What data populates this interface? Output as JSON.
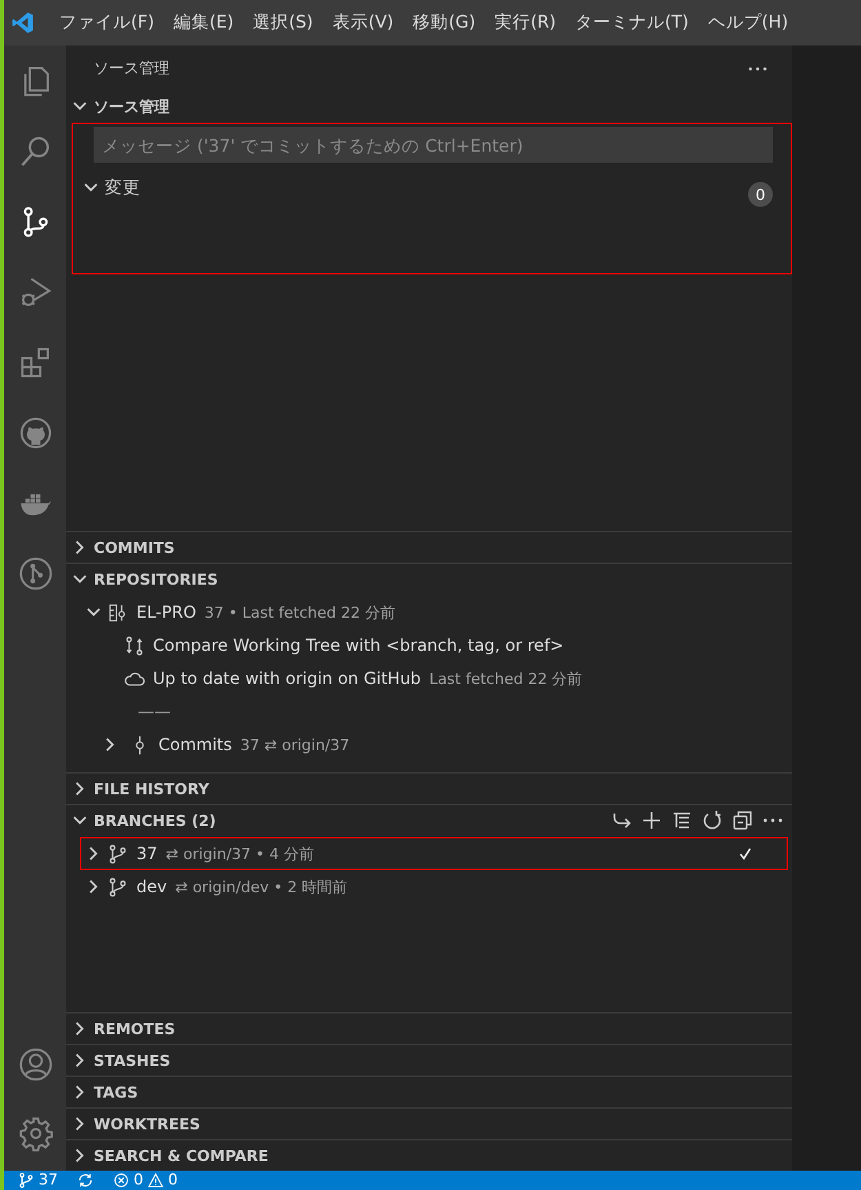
{
  "menu": [
    "ファイル(F)",
    "編集(E)",
    "選択(S)",
    "表示(V)",
    "移動(G)",
    "実行(R)",
    "ターミナル(T)",
    "ヘルプ(H)"
  ],
  "activity_bar": [
    {
      "kind": "files",
      "selected": false
    },
    {
      "kind": "search",
      "selected": false
    },
    {
      "kind": "scm",
      "selected": true
    },
    {
      "kind": "debug",
      "selected": false
    },
    {
      "kind": "extensions",
      "selected": false
    },
    {
      "kind": "github",
      "selected": false
    },
    {
      "kind": "docker",
      "selected": false
    },
    {
      "kind": "gitgraph",
      "selected": false
    }
  ],
  "activity_bottom": [
    {
      "kind": "account"
    },
    {
      "kind": "settings"
    }
  ],
  "sidebar": {
    "title": "ソース管理",
    "scm": {
      "title": "ソース管理",
      "expanded": true,
      "annotated": true,
      "placeholder": "メッセージ ('37' でコミットするための Ctrl+Enter)",
      "changes": {
        "label": "変更",
        "count": "0",
        "expanded": true
      }
    },
    "sections_top": [
      {
        "title": "COMMITS",
        "expanded": false
      }
    ],
    "repositories": {
      "title": "REPOSITORIES",
      "expanded": true,
      "repo": {
        "label": "EL-PRO",
        "description": "37 • Last fetched 22 分前",
        "expanded": true,
        "children": [
          {
            "kind": "compare",
            "label": "Compare Working Tree with <branch, tag, or ref>"
          },
          {
            "kind": "status",
            "label": "Up to date with origin on GitHub",
            "description": "Last fetched 22 分前"
          },
          {
            "kind": "separator",
            "label": "——"
          },
          {
            "kind": "commits",
            "label": "Commits",
            "description": "37 ⇄ origin/37",
            "expanded": false
          }
        ]
      }
    },
    "file_history": {
      "title": "FILE HISTORY",
      "expanded": false
    },
    "branches": {
      "title": "BRANCHES (2)",
      "expanded": true,
      "items": [
        {
          "name": "37",
          "tracking": "⇄ origin/37 • 4 分前",
          "current": true,
          "annotated": true
        },
        {
          "name": "dev",
          "tracking": "⇄ origin/dev • 2 時間前",
          "current": false,
          "annotated": false
        }
      ]
    },
    "sections_bottom": [
      {
        "title": "REMOTES",
        "expanded": false
      },
      {
        "title": "STASHES",
        "expanded": false
      },
      {
        "title": "TAGS",
        "expanded": false
      },
      {
        "title": "WORKTREES",
        "expanded": false
      },
      {
        "title": "SEARCH & COMPARE",
        "expanded": false
      }
    ]
  },
  "status_bar": {
    "branch": "37",
    "errors": "0",
    "warnings": "0"
  }
}
